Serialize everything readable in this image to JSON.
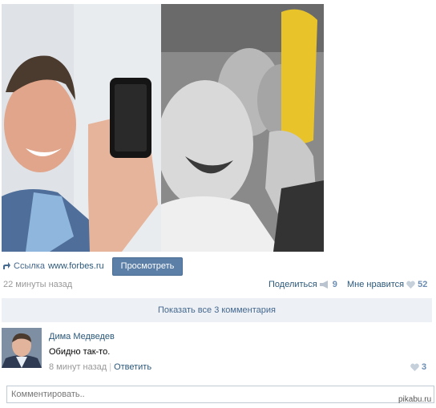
{
  "post": {
    "link": {
      "label": "Ссылка",
      "url": "www.forbes.ru",
      "button": "Просмотреть"
    },
    "time": "22 минуты назад",
    "share": {
      "label": "Поделиться",
      "count": "9"
    },
    "like": {
      "label": "Мне нравится",
      "count": "52"
    },
    "show_all": "Показать все 3 комментария"
  },
  "comment": {
    "author": "Дима Медведев",
    "text": "Обидно так-то.",
    "time": "8 минут назад",
    "reply": "Ответить",
    "likes": "3"
  },
  "comment_input": {
    "placeholder": "Комментировать.."
  },
  "watermark": "pikabu.ru",
  "colors": {
    "link": "#2b587a",
    "button": "#5b7fa6",
    "show_all_bg": "#edf1f5",
    "muted": "#999999"
  }
}
